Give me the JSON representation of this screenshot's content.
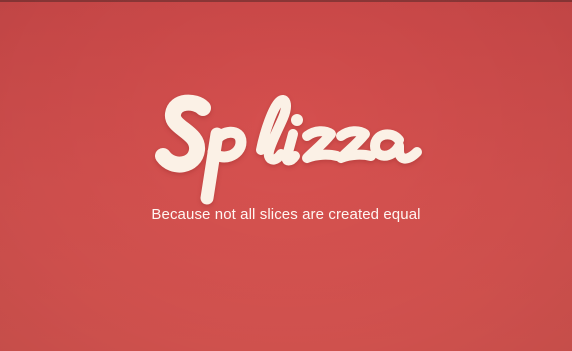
{
  "brand": {
    "logo_text": "Splizza",
    "tagline": "Because not all slices are created equal"
  },
  "colors": {
    "background_top": "#cf4a4a",
    "background_bottom": "#dc5652",
    "logo": "#fbf1e6",
    "tagline": "#fff6f2"
  }
}
